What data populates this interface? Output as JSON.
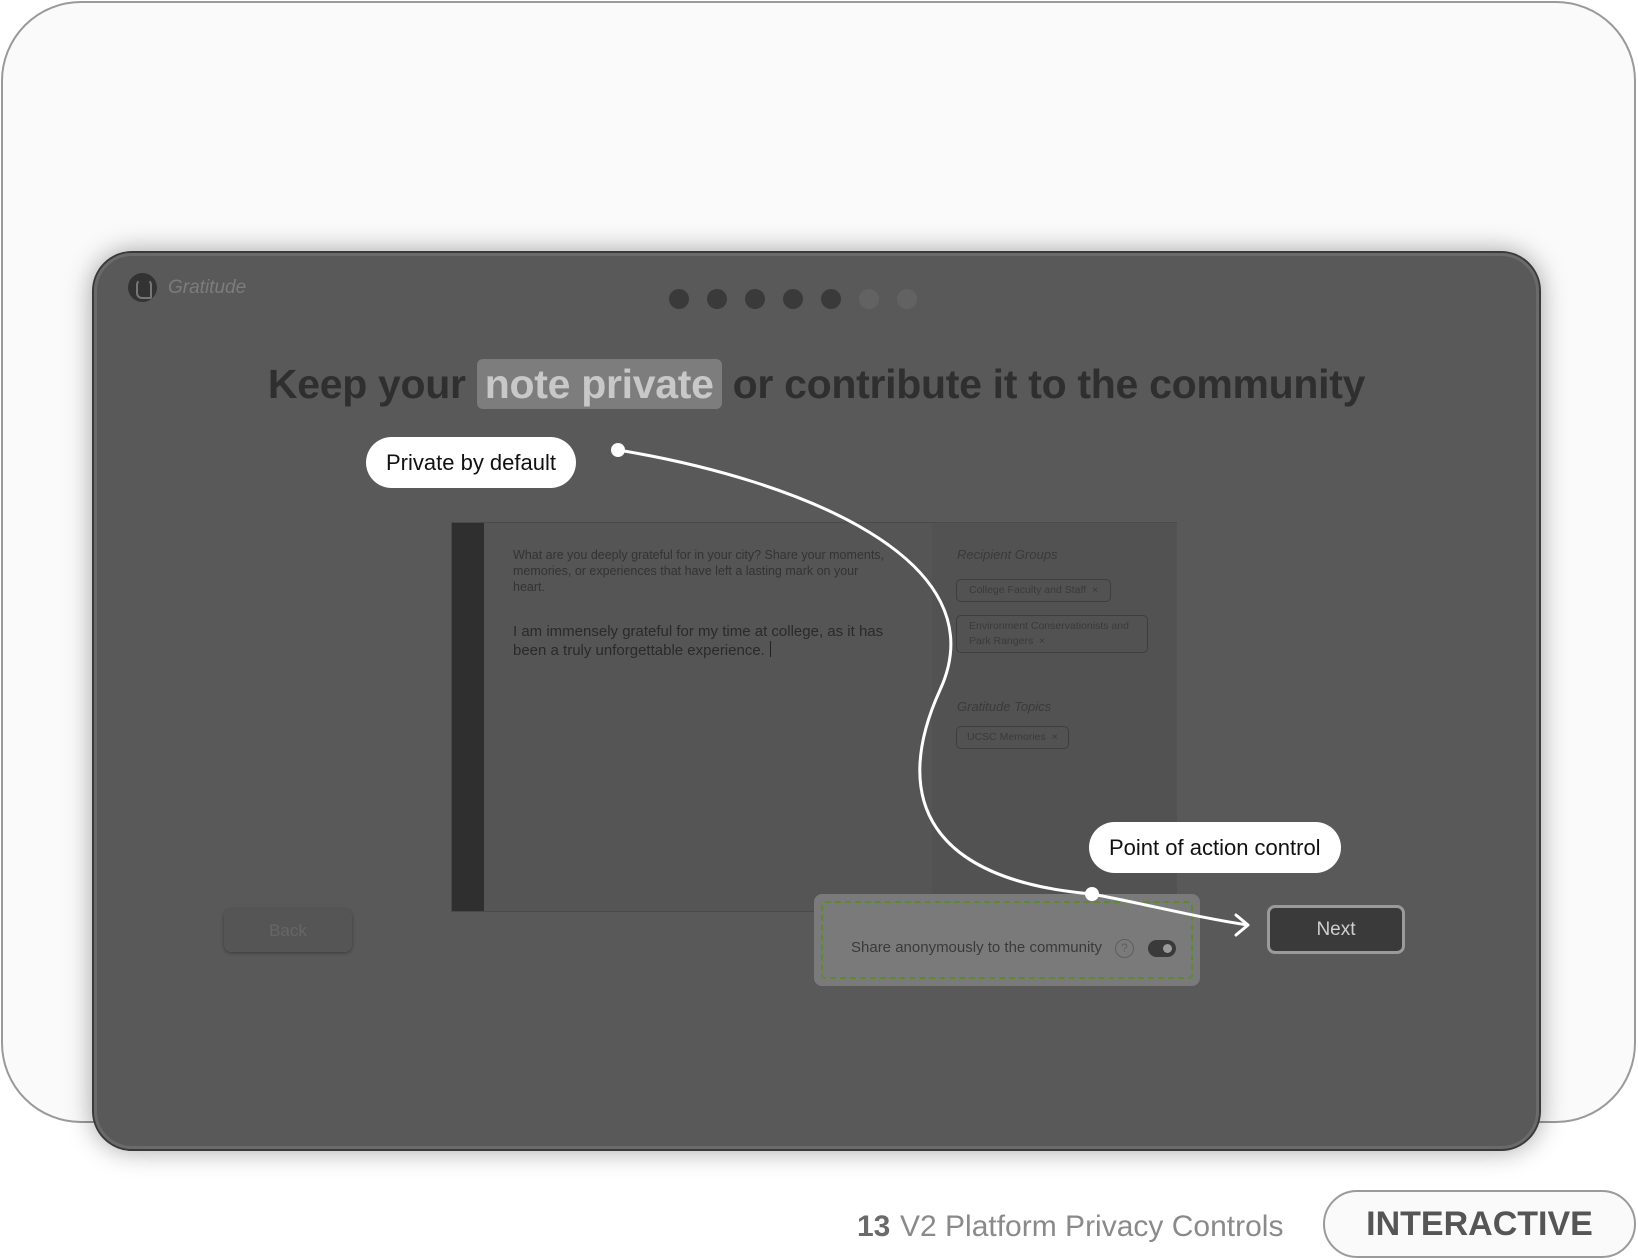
{
  "app": {
    "name": "Gratitude"
  },
  "progress": {
    "total_steps": 7,
    "completed_steps": 5
  },
  "headline": {
    "before": "Keep your ",
    "highlight": "note private",
    "after": " or contribute it to the community"
  },
  "note": {
    "prompt": "What are you deeply grateful for in your city? Share your moments, memories, or experiences that have left a lasting mark on your heart.",
    "entry": "I am immensely grateful for my time at college, as it has been a truly unforgettable experience."
  },
  "sidebar": {
    "recipient_title": "Recipient Groups",
    "recipients": [
      "College Faculty and Staff",
      "Environment Conservationists and Park Rangers"
    ],
    "topics_title": "Gratitude Topics",
    "topics": [
      "UCSC Memories"
    ],
    "remove_glyph": "×"
  },
  "share": {
    "label": "Share anonymously to the community",
    "help_glyph": "?",
    "toggle_on": true
  },
  "buttons": {
    "back": "Back",
    "next": "Next"
  },
  "callouts": {
    "private": "Private by default",
    "action": "Point of action control"
  },
  "footer": {
    "number": "13",
    "title": "V2 Platform Privacy Controls",
    "tag": "INTERACTIVE"
  },
  "colors": {
    "annotation": "#ffffff",
    "dashed_border": "#5c8a32"
  }
}
